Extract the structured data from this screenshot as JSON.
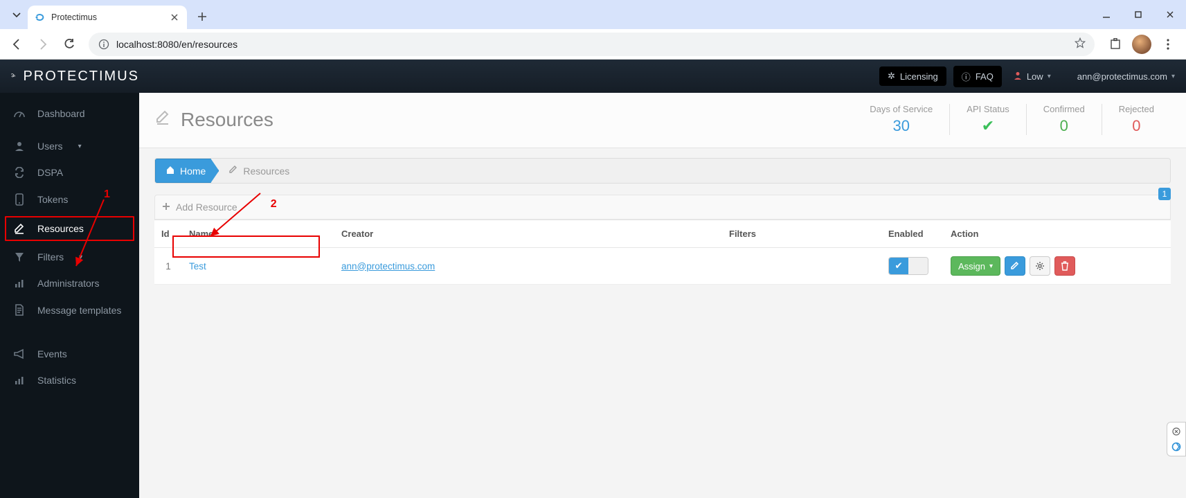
{
  "browser": {
    "tab_title": "Protectimus",
    "url": "localhost:8080/en/resources"
  },
  "topbar": {
    "brand": "PROTECTIMUS",
    "licensing": "Licensing",
    "faq": "FAQ",
    "user_low": "Low",
    "account_email": "ann@protectimus.com"
  },
  "sidebar": {
    "dashboard": "Dashboard",
    "users": "Users",
    "dspa": "DSPA",
    "tokens": "Tokens",
    "resources": "Resources",
    "filters": "Filters",
    "administrators": "Administrators",
    "message_templates": "Message templates",
    "events": "Events",
    "statistics": "Statistics"
  },
  "page": {
    "title": "Resources",
    "stats": {
      "days_label": "Days of Service",
      "days_value": "30",
      "api_label": "API Status",
      "confirmed_label": "Confirmed",
      "confirmed_value": "0",
      "rejected_label": "Rejected",
      "rejected_value": "0"
    },
    "breadcrumb": {
      "home": "Home",
      "resources": "Resources"
    },
    "add_resource": "Add Resource",
    "badge_count": "1",
    "columns": {
      "id": "Id",
      "name": "Name",
      "creator": "Creator",
      "filters": "Filters",
      "enabled": "Enabled",
      "action": "Action"
    },
    "row": {
      "id": "1",
      "name": "Test",
      "creator": "ann@protectimus.com",
      "assign": "Assign"
    }
  },
  "annotations": {
    "call1": "1",
    "call2": "2"
  }
}
